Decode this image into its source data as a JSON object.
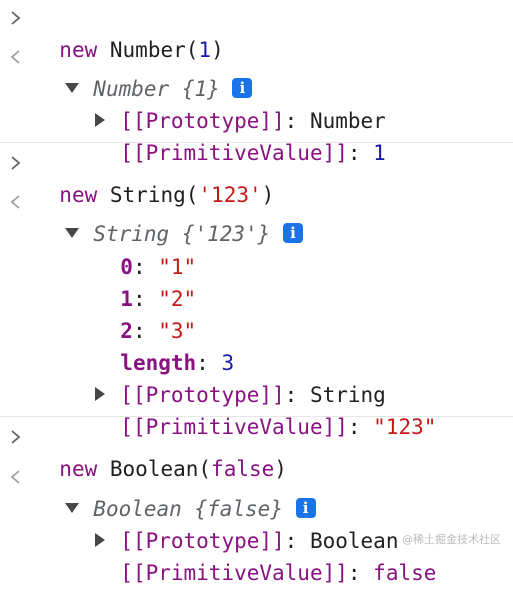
{
  "blocks": [
    {
      "input": {
        "kw": "new",
        "call": "Number(",
        "arg": "1",
        "close": ")"
      },
      "summary": {
        "type": "Number",
        "value": "{1}"
      },
      "props": [],
      "proto": {
        "key": "[[Prototype]]",
        "value": "Number"
      },
      "primitive": {
        "key": "[[PrimitiveValue]]",
        "value": "1"
      }
    },
    {
      "input": {
        "kw": "new",
        "call": "String(",
        "arg": "'123'",
        "close": ")"
      },
      "summary": {
        "type": "String",
        "value": "{'123'}"
      },
      "props": [
        {
          "key": "0",
          "value": "\"1\""
        },
        {
          "key": "1",
          "value": "\"2\""
        },
        {
          "key": "2",
          "value": "\"3\""
        },
        {
          "key": "length",
          "value": "3"
        }
      ],
      "proto": {
        "key": "[[Prototype]]",
        "value": "String"
      },
      "primitive": {
        "key": "[[PrimitiveValue]]",
        "value": "\"123\""
      }
    },
    {
      "input": {
        "kw": "new",
        "call": "Boolean(",
        "arg": "false",
        "close": ")"
      },
      "summary": {
        "type": "Boolean",
        "value": "{false}"
      },
      "props": [],
      "proto": {
        "key": "[[Prototype]]",
        "value": "Boolean"
      },
      "primitive": {
        "key": "[[PrimitiveValue]]",
        "value": "false"
      }
    }
  ],
  "icons": {
    "input_prompt": "chevron-right-icon",
    "output_prompt": "chevron-left-icon",
    "info": "info-icon"
  },
  "info_glyph": "i",
  "watermark": "@稀土掘金技术社区",
  "colors": {
    "keyword": "#881280",
    "number": "#1a1aa6",
    "string": "#c41a16",
    "info": "#1a73e8"
  }
}
